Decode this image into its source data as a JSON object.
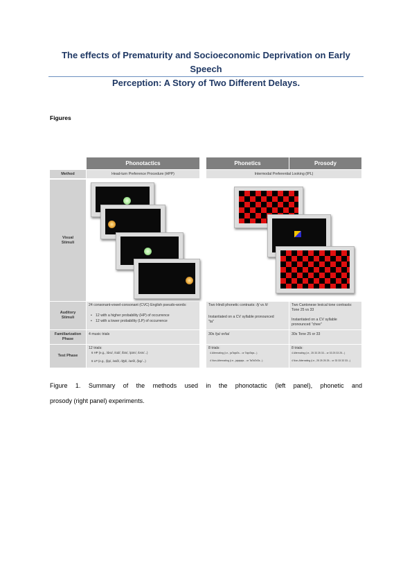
{
  "title_line1": "The effects of Prematurity and Socioeconomic Deprivation on Early Speech",
  "title_line2": "Perception: A Story of Two Different Delays.",
  "section_label": "Figures",
  "figure": {
    "headers": {
      "phonotactics": "Phonotactics",
      "phonetics": "Phonetics",
      "prosody": "Prosody"
    },
    "rows": {
      "method": "Method",
      "visual": "Visual\nStimuli",
      "auditory": "Auditory\nStimuli",
      "familiarization": "Familiarization\nPhase",
      "test": "Test Phase"
    },
    "method": {
      "phonotactics": "Head-turn Preference Procedure (HPP)",
      "phonetics_prosody": "Intermodal Preferential Looking (IPL)"
    },
    "auditory": {
      "phonotactics_intro": "24 consonant-vowel-consonant (CVC) English pseudo-words:",
      "phonotactics_bullet1": "12 with a higher probability (HP) of occurrence",
      "phonotactics_bullet2": "12 with a lower probability (LP) of occurrence",
      "phonetics_line1": "Two Hindi phonetic contrasts: /ʈ/ vs /t/",
      "phonetics_line2": "Instantiated on a CV syllable pronounced",
      "phonetics_line3": "\"ta\"",
      "prosody_line1": "Two Cantonese lexical tone contrasts:",
      "prosody_line2": "Tone 25 vs 33",
      "prosody_line3": "Instantiated on a CV syllable",
      "prosody_line4": "pronounced \"chee\""
    },
    "familiarization": {
      "phonotactics": "4 music trials",
      "phonetics": "30s /ʈa/ or/ta/",
      "prosody": "30s Tone 25 or 33"
    },
    "test": {
      "phonotactics_head": "12 trials:",
      "phonotactics_hp": "6 HP (e.g., /dʌs/, /sɪd/, /bɪs/, /pɪm/, /tʌm/...)",
      "phonotactics_lp": "6 LP (e.g., /ʃɪp/, /wɪð/, /ʤɪl/, /ɑeθ/, /ʃeg/...)",
      "phonetics_head": "8 trials:",
      "phonetics_alt": "4 Alternating (i.e., ʈaTaʈaTa... or TaʈaTaʈa...)",
      "phonetics_nonalt": "4 Non-Alternating (i.e., ʈaʈaʈaʈa... or TaTaTaTa...)",
      "prosody_head": "8 trials:",
      "prosody_alt": "4 Alternating (i.e., 25 33 25 33... or 33 25 33 25...)",
      "prosody_nonalt": "4 Non-Alternating (i.e., 25 25 25 25... or 33 33 33 33...)"
    }
  },
  "caption_line1": "Figure 1. Summary of the methods used in the phonotactic (left panel), phonetic and",
  "caption_line2": "prosody (right panel) experiments.",
  "colors": {
    "title": "#1f3864",
    "header": "#7f7f7f",
    "cell": "#e1e1e1",
    "checker_red": "#e01010"
  }
}
